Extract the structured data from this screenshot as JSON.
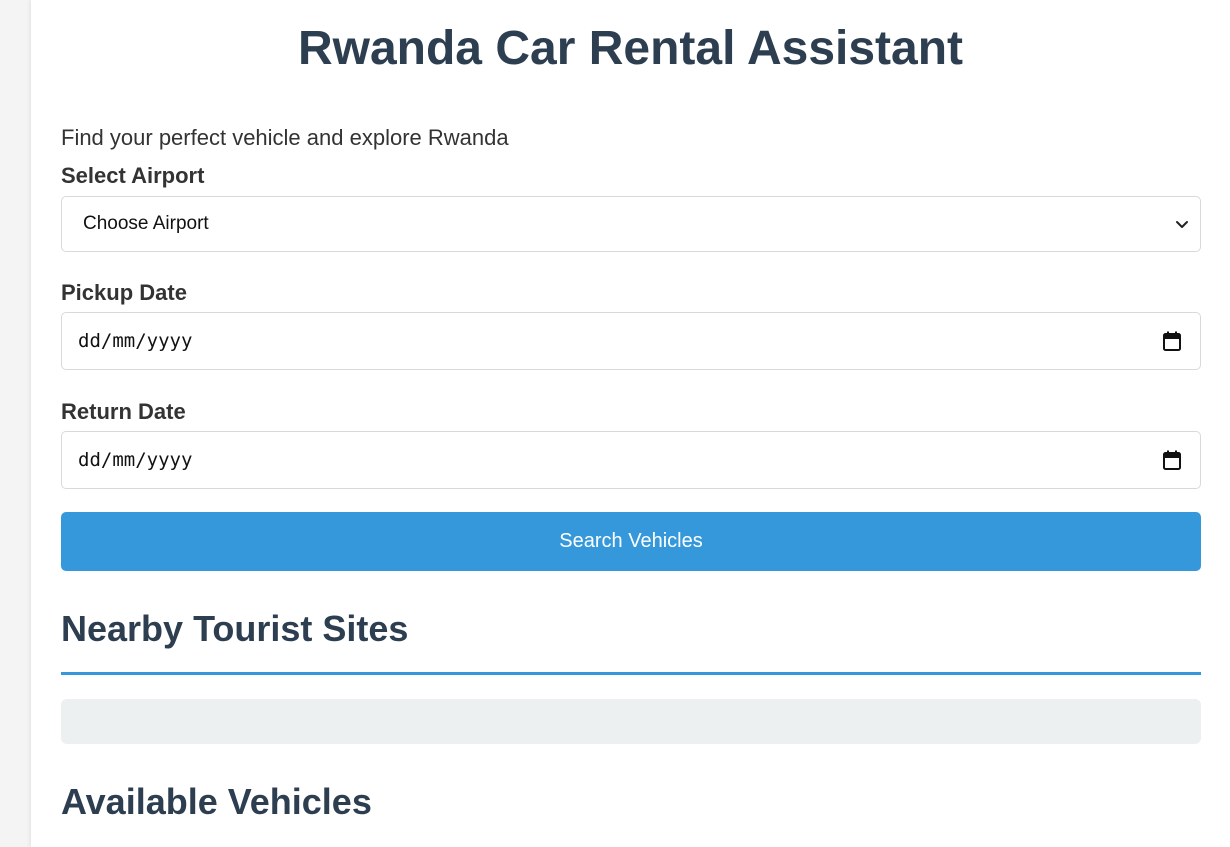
{
  "app": {
    "title": "Rwanda Car Rental Assistant",
    "subtitle": "Find your perfect vehicle and explore Rwanda"
  },
  "form": {
    "airport_label": "Select Airport",
    "airport_selected": "Choose Airport",
    "pickup_label": "Pickup Date",
    "pickup_value": "dd/mm/yyyy",
    "return_label": "Return Date",
    "return_value": "dd/mm/yyyy",
    "search_button": "Search Vehicles"
  },
  "sections": {
    "tourist_sites_title": "Nearby Tourist Sites",
    "vehicles_title": "Available Vehicles"
  },
  "colors": {
    "accent": "#3498db",
    "heading": "#2c3e50",
    "panel": "#ecf0f1"
  },
  "icons": {
    "select": "chevron-down-icon",
    "date": "calendar-icon"
  }
}
